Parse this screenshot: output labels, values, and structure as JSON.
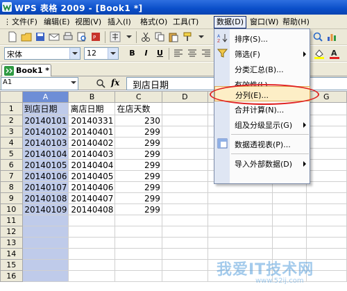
{
  "window": {
    "title": "WPS 表格 2009 - [Book1 *]"
  },
  "menubar": {
    "items": [
      "文件(F)",
      "编辑(E)",
      "视图(V)",
      "插入(I)",
      "格式(O)",
      "工具(T)",
      "数据(D)",
      "窗口(W)",
      "帮助(H)"
    ],
    "active": "数据(D)"
  },
  "format_toolbar": {
    "font_name": "宋体",
    "font_size": "12",
    "bold": "B",
    "italic": "I",
    "underline": "U"
  },
  "tabs": {
    "book_tab": "Book1 *"
  },
  "formula_bar": {
    "name_box": "A1",
    "fx": "fx",
    "value": "到店日期"
  },
  "sheet": {
    "columns": [
      "A",
      "B",
      "C",
      "D",
      "E",
      "F",
      "G"
    ],
    "rows": [
      "1",
      "2",
      "3",
      "4",
      "5",
      "6",
      "7",
      "8",
      "9",
      "10",
      "11",
      "12",
      "13",
      "14",
      "15",
      "16"
    ],
    "header_row": [
      "到店日期",
      "离店日期",
      "在店天数"
    ],
    "data": [
      [
        "20140101",
        "20140331",
        "230"
      ],
      [
        "20140102",
        "20140401",
        "299"
      ],
      [
        "20140103",
        "20140402",
        "299"
      ],
      [
        "20140104",
        "20140403",
        "299"
      ],
      [
        "20140105",
        "20140404",
        "299"
      ],
      [
        "20140106",
        "20140405",
        "299"
      ],
      [
        "20140107",
        "20140406",
        "299"
      ],
      [
        "20140108",
        "20140407",
        "299"
      ],
      [
        "20140109",
        "20140408",
        "299"
      ]
    ]
  },
  "data_menu": {
    "items": [
      {
        "label": "排序(S)...",
        "submenu": false
      },
      {
        "label": "筛选(F)",
        "submenu": true
      },
      {
        "label": "分类汇总(B)...",
        "submenu": false
      },
      {
        "label": "有效性(L)...",
        "submenu": false
      },
      {
        "label": "分列(E)...",
        "submenu": false,
        "highlighted": true
      },
      {
        "label": "合并计算(N)...",
        "submenu": false
      },
      {
        "label": "组及分级显示(G)",
        "submenu": true
      },
      {
        "label": "数据透视表(P)...",
        "submenu": false
      },
      {
        "label": "导入外部数据(D)",
        "submenu": true
      }
    ]
  },
  "watermark": {
    "text": "我爱IT技术网",
    "url": "www.52ij.com"
  },
  "colors": {
    "selected_column": "#6e8ed6",
    "highlight_oval": "#e02020",
    "menu_highlight": "#fdeec6"
  }
}
